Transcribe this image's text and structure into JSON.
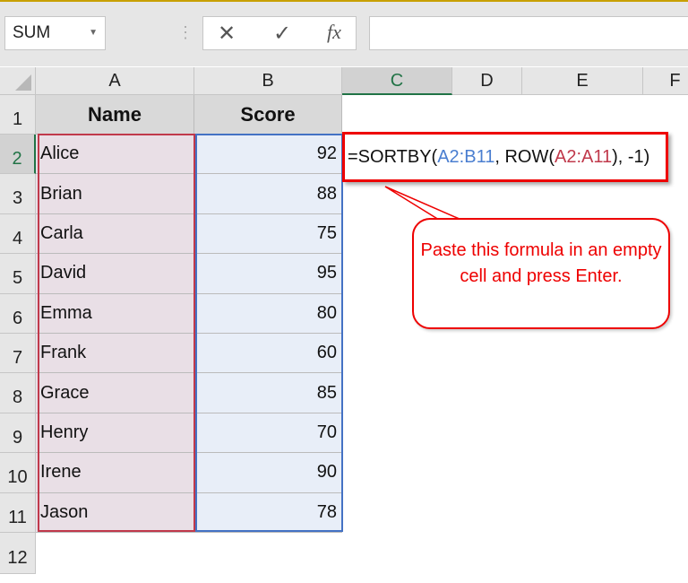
{
  "namebox": {
    "value": "SUM"
  },
  "formula_buttons": {
    "cancel": "✕",
    "enter": "✓",
    "fx": "fx"
  },
  "columns": [
    "A",
    "B",
    "C",
    "D",
    "E",
    "F"
  ],
  "rows": [
    "1",
    "2",
    "3",
    "4",
    "5",
    "6",
    "7",
    "8",
    "9",
    "10",
    "11",
    "12"
  ],
  "headers": {
    "name": "Name",
    "score": "Score"
  },
  "data": [
    {
      "name": "Alice",
      "score": "92"
    },
    {
      "name": "Brian",
      "score": "88"
    },
    {
      "name": "Carla",
      "score": "75"
    },
    {
      "name": "David",
      "score": "95"
    },
    {
      "name": "Emma",
      "score": "80"
    },
    {
      "name": "Frank",
      "score": "60"
    },
    {
      "name": "Grace",
      "score": "85"
    },
    {
      "name": "Henry",
      "score": "70"
    },
    {
      "name": "Irene",
      "score": "90"
    },
    {
      "name": "Jason",
      "score": "78"
    }
  ],
  "formula": {
    "p1": "=SORTBY(",
    "p2": "A2:B11",
    "p3": ", ROW(",
    "p4": "A2:A11",
    "p5": "), -1)"
  },
  "callout": {
    "text": "Paste this formula in an empty cell and press Enter."
  },
  "colors": {
    "accent": "#217346",
    "rangeA": "#c0394b",
    "rangeB": "#4472c4",
    "callout": "#ee0000"
  }
}
